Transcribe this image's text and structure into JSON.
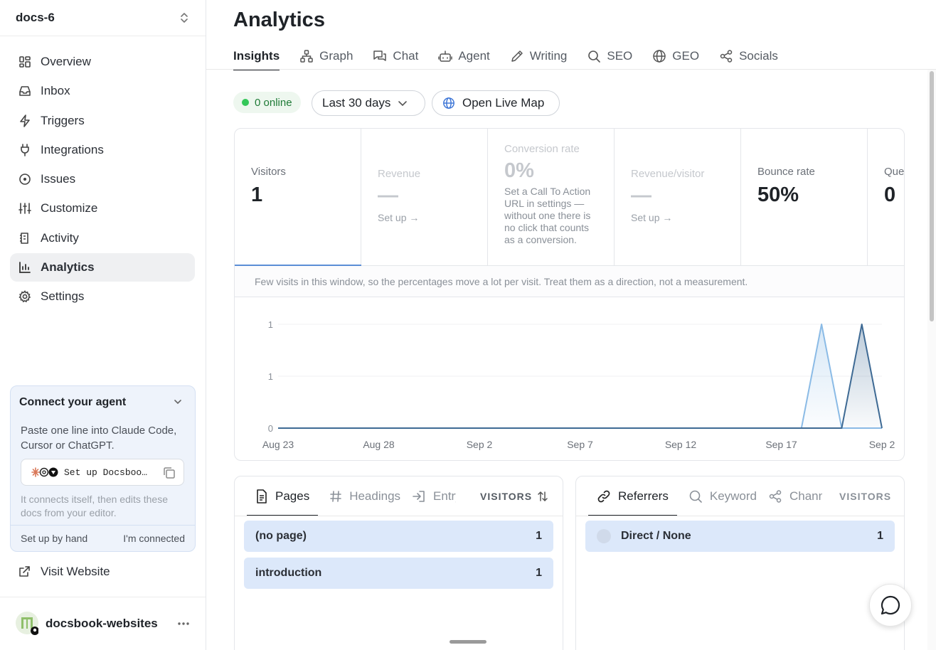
{
  "workspace": {
    "name": "docs-6"
  },
  "sidebar": {
    "items": [
      {
        "label": "Overview",
        "icon": "grid-icon"
      },
      {
        "label": "Inbox",
        "icon": "inbox-icon"
      },
      {
        "label": "Triggers",
        "icon": "bolt-icon"
      },
      {
        "label": "Integrations",
        "icon": "plug-icon"
      },
      {
        "label": "Issues",
        "icon": "circle-dot-icon"
      },
      {
        "label": "Customize",
        "icon": "sliders-icon"
      },
      {
        "label": "Activity",
        "icon": "activity-icon"
      },
      {
        "label": "Analytics",
        "icon": "bar-chart-icon",
        "active": true
      },
      {
        "label": "Settings",
        "icon": "gear-icon"
      }
    ]
  },
  "agent_card": {
    "title": "Connect your agent",
    "description": "Paste one line into Claude Code, Cursor or ChatGPT.",
    "command": "Set up Docsbook for",
    "command_display": "Set up Docsboo…",
    "note": "It connects itself, then edits these docs from your editor.",
    "setup_by_hand": "Set up by hand",
    "connected": "I'm connected"
  },
  "visit_website": "Visit Website",
  "account": {
    "name": "docsbook-websites"
  },
  "page": {
    "title": "Analytics"
  },
  "tabs": [
    "Insights",
    "Graph",
    "Chat",
    "Agent",
    "Writing",
    "SEO",
    "GEO",
    "Socials"
  ],
  "filters": {
    "online": "0 online",
    "range": "Last 30 days",
    "live_map": "Open Live Map"
  },
  "stats": [
    {
      "label": "Visitors",
      "value": "1"
    },
    {
      "label": "Revenue",
      "value": "—",
      "link": "Set up →"
    },
    {
      "label": "Conversion rate",
      "value": "0%",
      "desc": "Set a Call To Action URL in settings — without one there is no click that counts as a conversion."
    },
    {
      "label": "Revenue/visitor",
      "value": "—",
      "link": "Set up →"
    },
    {
      "label": "Bounce rate",
      "value": "50%"
    },
    {
      "label": "Que",
      "value": "0"
    }
  ],
  "notice": "Few visits in this window, so the percentages move a lot per visit. Treat them as a direction, not a measurement.",
  "chart_data": {
    "type": "area",
    "x_ticks": [
      "Aug 23",
      "Aug 28",
      "Sep 2",
      "Sep 7",
      "Sep 12",
      "Sep 17",
      "Sep 2"
    ],
    "y_ticks": [
      "0",
      "1",
      "1"
    ],
    "ylim": [
      0,
      1
    ],
    "days": 31,
    "series": [
      {
        "values": [
          0,
          0,
          0,
          0,
          0,
          0,
          0,
          0,
          0,
          0,
          0,
          0,
          0,
          0,
          0,
          0,
          0,
          0,
          0,
          0,
          0,
          0,
          0,
          0,
          0,
          0,
          0,
          1,
          0,
          0,
          0
        ],
        "color": "#8bbbe6"
      },
      {
        "values": [
          0,
          0,
          0,
          0,
          0,
          0,
          0,
          0,
          0,
          0,
          0,
          0,
          0,
          0,
          0,
          0,
          0,
          0,
          0,
          0,
          0,
          0,
          0,
          0,
          0,
          0,
          0,
          0,
          0,
          1,
          0
        ],
        "color": "#3e6a94"
      }
    ]
  },
  "pages_panel": {
    "tabs": [
      "Pages",
      "Headings",
      "Entry"
    ],
    "column": "VISITORS",
    "rows": [
      {
        "label": "(no page)",
        "value": "1"
      },
      {
        "label": "introduction",
        "value": "1"
      }
    ]
  },
  "referrers_panel": {
    "tabs": [
      "Referrers",
      "Keyword",
      "Channels"
    ],
    "column": "VISITORS",
    "rows": [
      {
        "label": "Direct / None",
        "value": "1"
      }
    ]
  }
}
